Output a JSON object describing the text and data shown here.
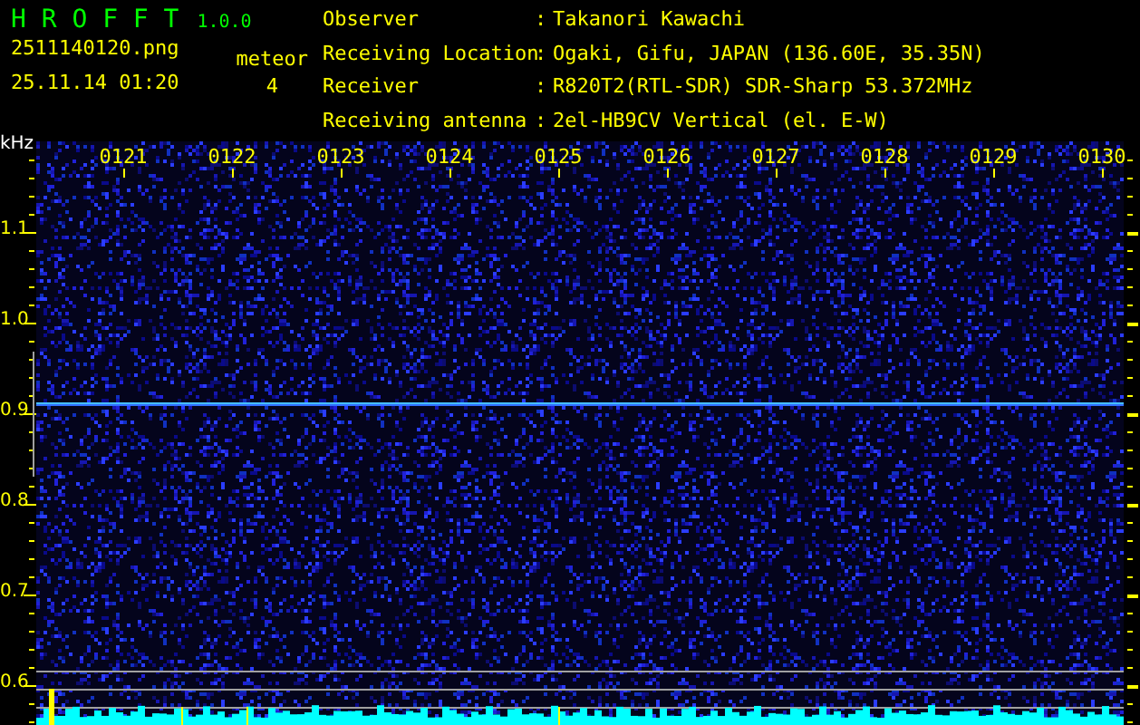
{
  "header": {
    "app_name": "H R O F F T",
    "version": "1.0.0",
    "filename": "2511140120.png",
    "datetime": "25.11.14 01:20",
    "meteor_label": "meteor",
    "meteor_count": "4"
  },
  "info": [
    {
      "label": "Observer",
      "separator": ":",
      "value": "Takanori Kawachi"
    },
    {
      "label": "Receiving Location",
      "separator": ":",
      "value": "Ogaki, Gifu, JAPAN (136.60E, 35.35N)"
    },
    {
      "label": "Receiver",
      "separator": ":",
      "value": "R820T2(RTL-SDR) SDR-Sharp 53.372MHz"
    },
    {
      "label": "Receiving antenna",
      "separator": ":",
      "value": "2el-HB9CV Vertical (el. E-W)"
    }
  ],
  "axis": {
    "unit": "kHz",
    "frequency_labels": [
      "1.1",
      "1.0",
      "0.9",
      "0.8",
      "0.7",
      "0.6"
    ],
    "time_labels": [
      "0121",
      "0122",
      "0123",
      "0124",
      "0125",
      "0126",
      "0127",
      "0128",
      "0129",
      "0130"
    ]
  }
}
